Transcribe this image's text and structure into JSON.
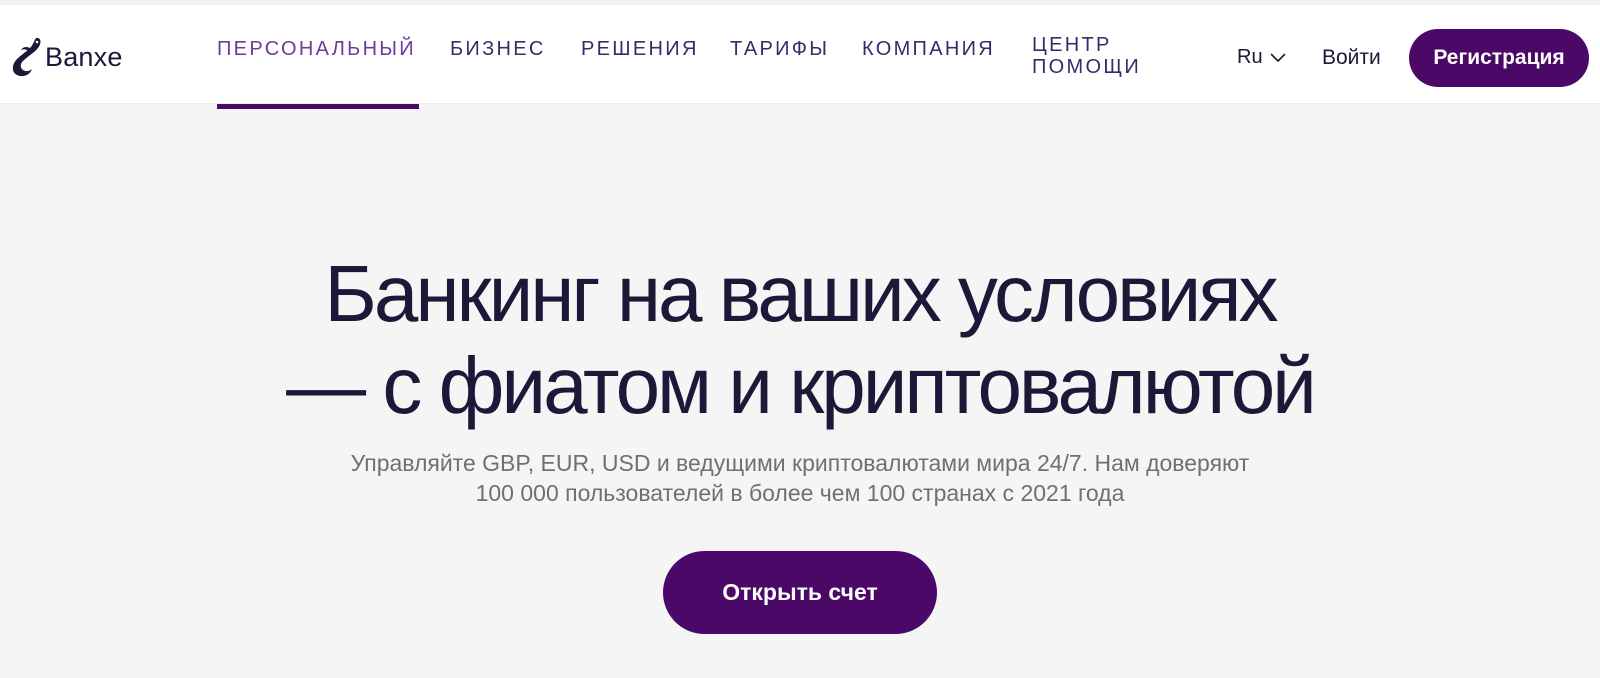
{
  "brand": {
    "name": "Banxe",
    "logo_icon": "banxe-whale-logo"
  },
  "nav": {
    "items": [
      {
        "label": "ПЕРСОНАЛЬНЫЙ",
        "active": true
      },
      {
        "label": "БИЗНЕС",
        "active": false
      },
      {
        "label": "РЕШЕНИЯ",
        "active": false
      },
      {
        "label": "ТАРИФЫ",
        "active": false
      },
      {
        "label": "КОМПАНИЯ",
        "active": false
      }
    ],
    "help": {
      "line1": "ЦЕНТР",
      "line2": "ПОМОЩИ"
    }
  },
  "header_actions": {
    "language": "Ru",
    "language_icon": "chevron-down-icon",
    "login": "Войти",
    "register": "Регистрация"
  },
  "hero": {
    "title_line1": "Банкинг на ваших условиях",
    "title_line2": "— с фиатом и криптовалютой",
    "subtitle_line1": "Управляйте GBP, EUR, USD и ведущими криптовалютами мира 24/7. Нам доверяют",
    "subtitle_line2": "100 000 пользователей в более чем 100 странах с 2021 года",
    "cta": "Открыть счет"
  },
  "colors": {
    "brand_purple": "#4b0867",
    "text_dark": "#1d1738",
    "nav_text": "#3a2a6a",
    "nav_active": "#6a3d97",
    "page_bg": "#f5f5f5",
    "subtitle_gray": "#707070"
  }
}
